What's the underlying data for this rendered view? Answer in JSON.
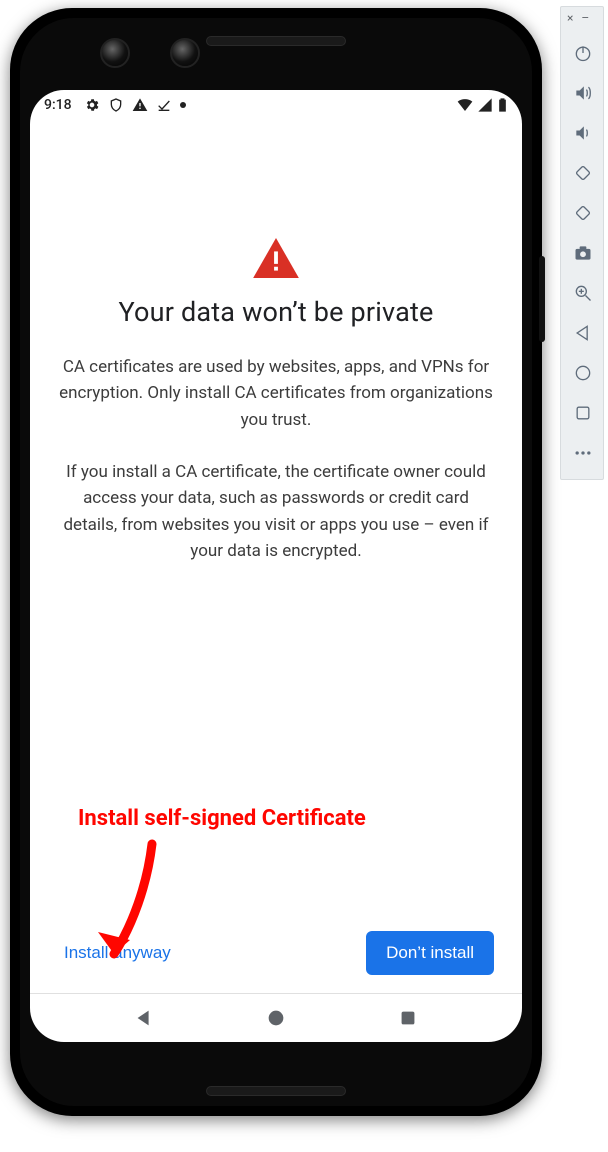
{
  "statusbar": {
    "time": "9:18",
    "icons_left": [
      "gear-icon",
      "shield-icon",
      "warning-icon",
      "check-icon",
      "dot-icon"
    ],
    "icons_right": [
      "wifi-icon",
      "signal-icon",
      "battery-icon"
    ]
  },
  "dialog": {
    "icon": "warning-triangle-icon",
    "icon_color": "#d93025",
    "title": "Your data won’t be private",
    "paragraph1": "CA certificates are used by websites, apps, and VPNs for encryption. Only install CA certificates from organizations you trust.",
    "paragraph2": "If you install a CA certificate, the certificate owner could access your data, such as passwords or credit card details, from websites you visit or apps you use – even if your data is encrypted.",
    "install_label": "Install anyway",
    "dont_install_label": "Don’t install"
  },
  "navbar": {
    "back": "back-icon",
    "home": "home-icon",
    "recents": "recents-icon"
  },
  "annotation": {
    "text": "Install self-signed Certificate",
    "color": "#ff0600"
  },
  "emulator_toolbar": {
    "close_label": "×",
    "minimize_label": "–",
    "buttons": [
      {
        "name": "power-icon"
      },
      {
        "name": "volume-up-icon"
      },
      {
        "name": "volume-down-icon"
      },
      {
        "name": "rotate-left-icon"
      },
      {
        "name": "rotate-right-icon"
      },
      {
        "name": "camera-icon"
      },
      {
        "name": "zoom-icon"
      },
      {
        "name": "back-icon"
      },
      {
        "name": "home-icon"
      },
      {
        "name": "recents-icon"
      },
      {
        "name": "more-icon"
      }
    ]
  },
  "colors": {
    "accent": "#1a73e8",
    "warning": "#d93025",
    "annotation": "#ff0600",
    "toolbar_bg": "#eceff1",
    "nav_icon": "#5f6368"
  }
}
